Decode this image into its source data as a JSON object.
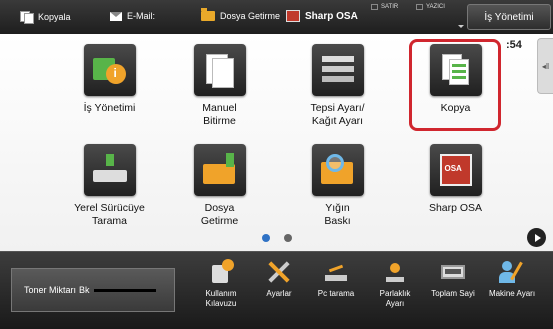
{
  "topbar": {
    "items": [
      {
        "label": "Kopyala",
        "icon": "copy-icon"
      },
      {
        "label": "E-Mail:",
        "icon": "mail-icon"
      },
      {
        "label": "Dosya Getirme",
        "icon": "folder-icon"
      },
      {
        "label": "Sharp OSA",
        "icon": "osa-icon"
      }
    ],
    "status_left": "SATIR",
    "status_right": "YAZICI",
    "job_button": "İş Yönetimi"
  },
  "main": {
    "time": ":54",
    "side_tab": "◂‖",
    "tiles": [
      {
        "line1": "İş Yönetimi",
        "line2": "",
        "icon": "job-status-icon"
      },
      {
        "line1": "Manuel",
        "line2": "Bitirme",
        "icon": "manual-finishing-icon"
      },
      {
        "line1": "Tepsi Ayarı/",
        "line2": "Kağıt Ayarı",
        "icon": "tray-settings-icon"
      },
      {
        "line1": "Kopya",
        "line2": "",
        "icon": "copy-icon"
      },
      {
        "line1": "Yerel Sürücüye",
        "line2": "Tarama",
        "icon": "scan-to-local-drive-icon"
      },
      {
        "line1": "Dosya",
        "line2": "Getirme",
        "icon": "folder-retrieve-icon"
      },
      {
        "line1": "Yığın",
        "line2": "Baskı",
        "icon": "bulk-print-icon"
      },
      {
        "line1": "Sharp OSA",
        "line2": "",
        "icon": "sharp-osa-icon"
      }
    ],
    "selected_tile": "Kopya",
    "page_indicator": {
      "current": 1,
      "total": 2
    }
  },
  "bottom": {
    "toner_label": "Toner Miktarı",
    "toner_value": "Bk",
    "items": [
      {
        "line1": "Kullanım",
        "line2": "Kılavuzu",
        "icon": "user-guide-icon"
      },
      {
        "line1": "Ayarlar",
        "line2": "",
        "icon": "settings-icon"
      },
      {
        "line1": "Pc tarama",
        "line2": "",
        "icon": "pc-scan-icon"
      },
      {
        "line1": "Parlaklık",
        "line2": "Ayarı",
        "icon": "brightness-icon"
      },
      {
        "line1": "Toplam Sayi",
        "line2": "",
        "icon": "total-count-icon"
      },
      {
        "line1": "Makine Ayarı",
        "line2": "",
        "icon": "machine-settings-icon"
      }
    ]
  },
  "colors": {
    "highlight": "#d0262e",
    "page_dot_active": "#2f72c5",
    "accent_green": "#58b449",
    "accent_orange": "#f0a32a"
  }
}
